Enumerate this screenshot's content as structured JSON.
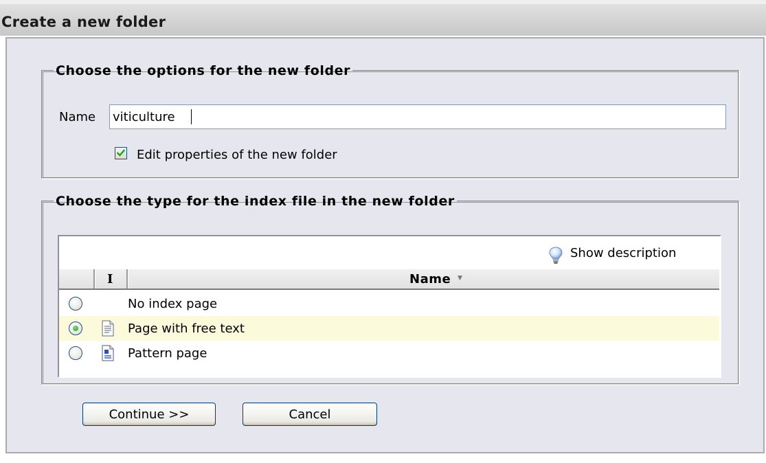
{
  "window": {
    "title": "Create a new folder"
  },
  "options_group": {
    "legend": "Choose the options for the new folder",
    "name_label": "Name",
    "name_value": "viticulture",
    "edit_properties_checked": true,
    "edit_properties_label": "Edit properties of the new folder"
  },
  "type_group": {
    "legend": "Choose the type for the index file in the new folder",
    "show_description": "Show description",
    "columns": {
      "icon": "I",
      "name": "Name"
    },
    "rows": [
      {
        "label": "No index page",
        "icon": "none",
        "selected": false
      },
      {
        "label": "Page with free text",
        "icon": "text-page-icon",
        "selected": true
      },
      {
        "label": "Pattern page",
        "icon": "pattern-page-icon",
        "selected": false
      }
    ]
  },
  "buttons": {
    "continue": "Continue >>",
    "cancel": "Cancel"
  },
  "colors": {
    "selected_row": "#fbfbdc",
    "dialog_bg": "#e6e6ee",
    "radio_dot": "#1f9b1f"
  }
}
